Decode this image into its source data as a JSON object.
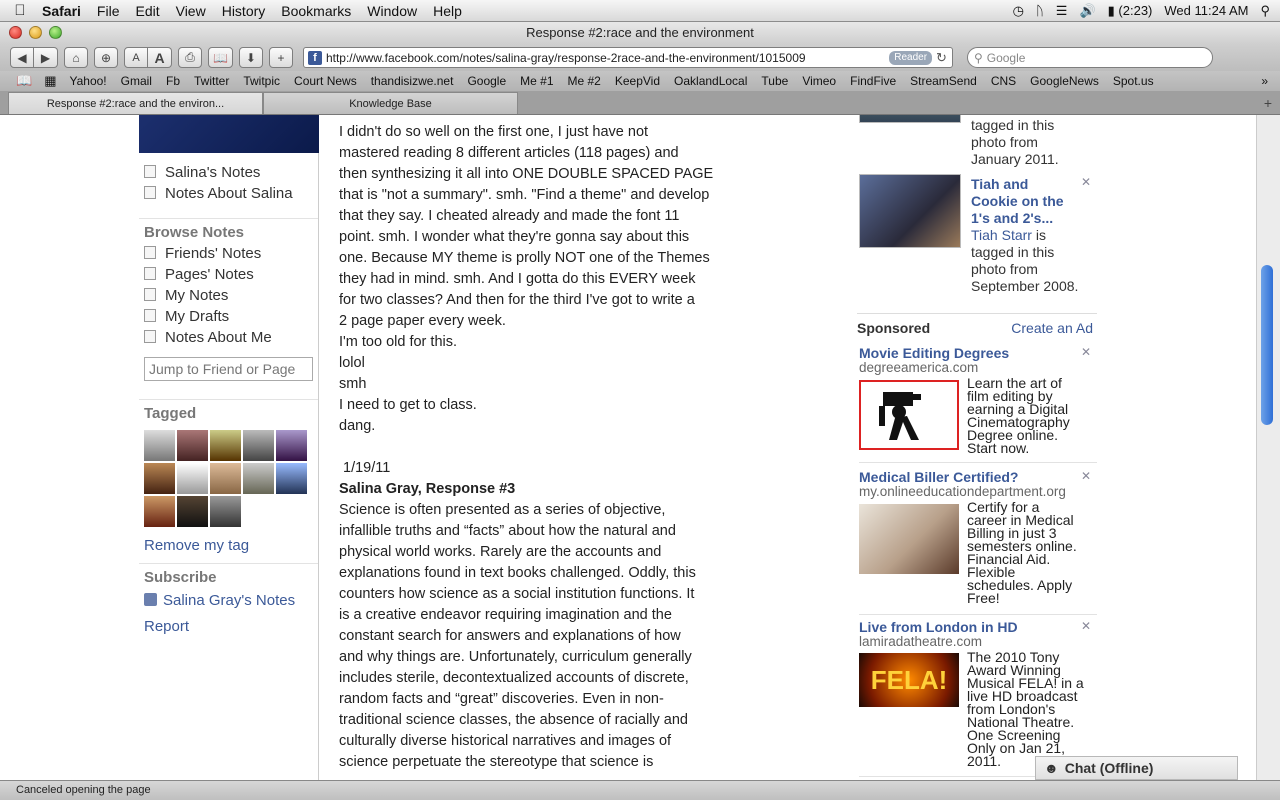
{
  "menubar": {
    "app": "Safari",
    "items": [
      "File",
      "Edit",
      "View",
      "History",
      "Bookmarks",
      "Window",
      "Help"
    ],
    "battery": "(2:23)",
    "clock": "Wed 11:24 AM"
  },
  "window": {
    "title": "Response #2:race and the environment"
  },
  "toolbar": {
    "url": "http://www.facebook.com/notes/salina-gray/response-2race-and-the-environment/1015009",
    "reader": "Reader",
    "search_placeholder": "Google",
    "font_small": "A",
    "font_large": "A"
  },
  "bookmarks": [
    "Yahoo!",
    "Gmail",
    "Fb",
    "Twitter",
    "Twitpic",
    "Court News",
    "thandisizwe.net",
    "Google",
    "Me #1",
    "Me #2",
    "KeepVid",
    "OaklandLocal",
    "Tube",
    "Vimeo",
    "FindFive",
    "StreamSend",
    "CNS",
    "GoogleNews",
    "Spot.us"
  ],
  "tabs": [
    "Response #2:race and the environ...",
    "Knowledge Base"
  ],
  "left": {
    "links1": [
      "Salina's Notes",
      "Notes About Salina"
    ],
    "browse_heading": "Browse Notes",
    "browse": [
      "Friends' Notes",
      "Pages' Notes",
      "My Notes",
      "My Drafts",
      "Notes About Me"
    ],
    "jump_placeholder": "Jump to Friend or Page",
    "tagged_heading": "Tagged",
    "remove_tag": "Remove my tag",
    "subscribe_heading": "Subscribe",
    "subscribe_link": "Salina Gray's Notes",
    "report": "Report"
  },
  "content": {
    "para1": [
      "I didn't do so well on the first one, I just have not",
      "mastered reading 8 different articles (118 pages) and",
      "then synthesizing it all into ONE DOUBLE SPACED PAGE",
      "that is \"not a summary\". smh. \"Find a theme\" and develop",
      "that they say. I cheated already and made the font 11",
      "point. smh. I wonder what they're gonna say about this",
      "one. Because MY theme is prolly NOT one of the Themes",
      "they had in mind.  smh. And I gotta do this EVERY week",
      "for two classes? And then for the third I've got to write a",
      "2 page paper every week.",
      "I'm too old for this.",
      "lolol",
      "smh",
      "I need to get to class.",
      "dang."
    ],
    "date": "1/19/11",
    "heading": "Salina Gray, Response #3",
    "para2": [
      "Science is often presented as a series of objective,",
      "infallible truths and “facts” about how the natural and",
      "physical world works.   Rarely are the accounts and",
      "explanations found in text books challenged. Oddly, this",
      "counters how science as a social institution functions. It",
      "is a creative endeavor requiring imagination and the",
      "constant search for answers and explanations of how",
      "and why things are. Unfortunately,  curriculum generally",
      "includes sterile, decontextualized accounts of discrete,",
      "random facts and “great” discoveries.  Even in non-",
      "traditional science classes, the absence of racially and",
      "culturally diverse historical narratives and images of",
      "science perpetuate the stereotype that science is"
    ]
  },
  "right": {
    "photo1_text": [
      "tagged in this",
      "photo from",
      "January 2011."
    ],
    "photo2_title": [
      "Tiah and",
      "Cookie on the",
      "1's and 2's..."
    ],
    "photo2_person": "Tiah Starr",
    "photo2_rest": [
      " is",
      "tagged in this",
      "photo from",
      "September 2008."
    ],
    "sponsored": "Sponsored",
    "create_ad": "Create an Ad",
    "ads": [
      {
        "title": "Movie Editing Degrees",
        "domain": "degreeamerica.com",
        "body": [
          "Learn the art of",
          "film editing by",
          "earning a Digital",
          "Cinematography",
          "Degree online.",
          "Start now."
        ]
      },
      {
        "title": "Medical Biller Certified?",
        "domain": "my.onlineeducationdepartment.org",
        "body": [
          "Certify for a",
          "career in Medical",
          "Billing in just 3",
          "semesters online.",
          "Financial Aid.",
          "Flexible",
          "schedules. Apply",
          "Free!"
        ]
      },
      {
        "title": "Live from London in HD",
        "domain": "lamiradatheatre.com",
        "body": [
          "The 2010 Tony",
          "Award Winning",
          "Musical FELA! in a",
          "live HD broadcast",
          "from London's",
          "National Theatre.",
          "One Screening",
          "Only on Jan 21,",
          "2011."
        ],
        "image_text": "FELA!"
      }
    ],
    "chat": "Chat (Offline)"
  },
  "status": "Canceled opening the page",
  "colors": {
    "fb_blue": "#3b5998"
  }
}
